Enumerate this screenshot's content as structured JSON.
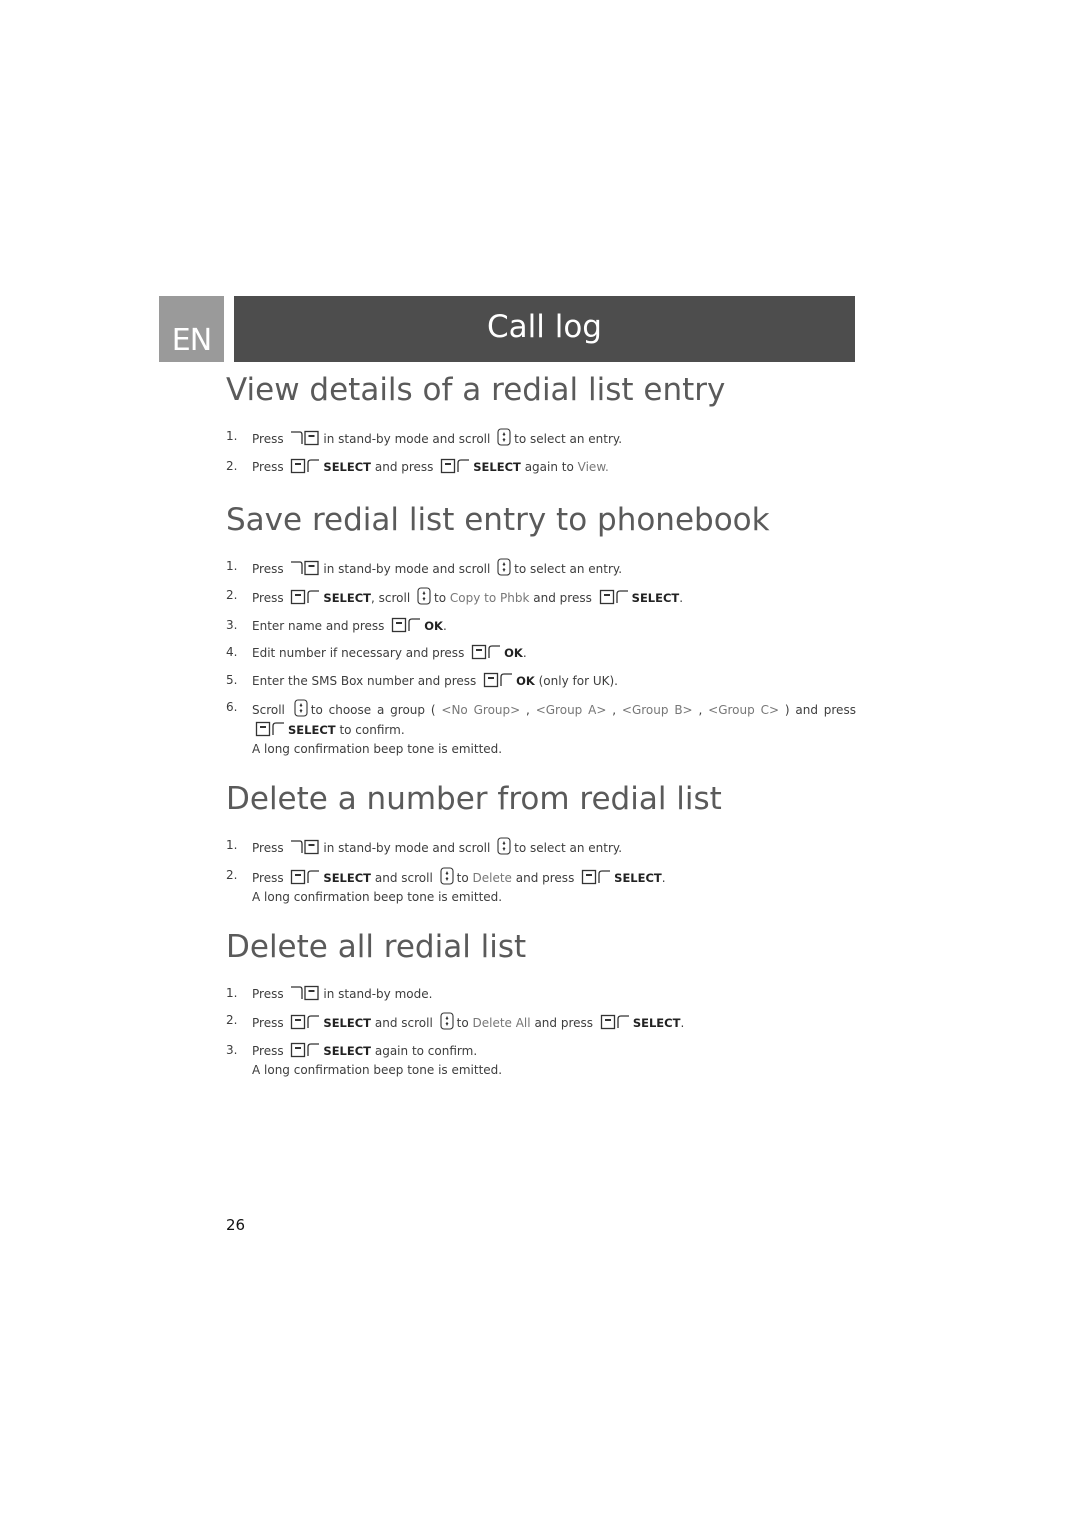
{
  "header": {
    "language": "EN",
    "title": "Call log"
  },
  "sections": [
    {
      "heading": "View details of a redial list entry",
      "steps": [
        {
          "num": "1.",
          "parts": [
            {
              "t": "text",
              "v": "Press"
            },
            {
              "t": "icon",
              "v": "call-key-icon"
            },
            {
              "t": "text",
              "v": "in stand-by mode and scroll"
            },
            {
              "t": "icon",
              "v": "nav-scroll-icon"
            },
            {
              "t": "text",
              "v": "to select an entry."
            }
          ]
        },
        {
          "num": "2.",
          "parts": [
            {
              "t": "text",
              "v": "Press"
            },
            {
              "t": "icon",
              "v": "left-softkey-icon"
            },
            {
              "t": "key",
              "v": "SELECT"
            },
            {
              "t": "text",
              "v": "and press"
            },
            {
              "t": "icon",
              "v": "left-softkey-icon"
            },
            {
              "t": "key",
              "v": "SELECT"
            },
            {
              "t": "text",
              "v": "again to"
            },
            {
              "t": "hl",
              "v": "View."
            }
          ]
        }
      ]
    },
    {
      "heading": "Save redial list entry to phonebook",
      "steps": [
        {
          "num": "1.",
          "parts": [
            {
              "t": "text",
              "v": "Press"
            },
            {
              "t": "icon",
              "v": "call-key-icon"
            },
            {
              "t": "text",
              "v": "in stand-by mode and scroll"
            },
            {
              "t": "icon",
              "v": "nav-scroll-icon"
            },
            {
              "t": "text",
              "v": "to select an entry."
            }
          ]
        },
        {
          "num": "2.",
          "parts": [
            {
              "t": "text",
              "v": "Press"
            },
            {
              "t": "icon",
              "v": "left-softkey-icon"
            },
            {
              "t": "key",
              "v": "SELECT"
            },
            {
              "t": "text",
              "v": ", scroll"
            },
            {
              "t": "icon",
              "v": "nav-scroll-icon"
            },
            {
              "t": "text",
              "v": "to"
            },
            {
              "t": "hl",
              "v": "Copy to Phbk"
            },
            {
              "t": "text",
              "v": "and press"
            },
            {
              "t": "icon",
              "v": "left-softkey-icon"
            },
            {
              "t": "key",
              "v": "SELECT"
            },
            {
              "t": "text",
              "v": "."
            }
          ]
        },
        {
          "num": "3.",
          "parts": [
            {
              "t": "text",
              "v": "Enter name and press"
            },
            {
              "t": "icon",
              "v": "left-softkey-icon"
            },
            {
              "t": "key",
              "v": "OK"
            },
            {
              "t": "text",
              "v": "."
            }
          ]
        },
        {
          "num": "4.",
          "parts": [
            {
              "t": "text",
              "v": "Edit number if necessary and press"
            },
            {
              "t": "icon",
              "v": "left-softkey-icon"
            },
            {
              "t": "key",
              "v": "OK"
            },
            {
              "t": "text",
              "v": "."
            }
          ]
        },
        {
          "num": "5.",
          "parts": [
            {
              "t": "text",
              "v": "Enter the SMS Box number and press"
            },
            {
              "t": "icon",
              "v": "left-softkey-icon"
            },
            {
              "t": "key",
              "v": "OK"
            },
            {
              "t": "text",
              "v": "(only for UK)."
            }
          ]
        },
        {
          "num": "6.",
          "justify": true,
          "parts": [
            {
              "t": "text",
              "v": "Scroll"
            },
            {
              "t": "icon",
              "v": "nav-scroll-icon"
            },
            {
              "t": "text",
              "v": "to choose a group ("
            },
            {
              "t": "hl",
              "v": "<No Group>"
            },
            {
              "t": "text",
              "v": ","
            },
            {
              "t": "hl",
              "v": "<Group A>"
            },
            {
              "t": "text",
              "v": ","
            },
            {
              "t": "hl",
              "v": "<Group B>"
            },
            {
              "t": "text",
              "v": ","
            },
            {
              "t": "hl",
              "v": "<Group C>"
            },
            {
              "t": "text",
              "v": ") and press"
            },
            {
              "t": "icon",
              "v": "left-softkey-icon"
            },
            {
              "t": "key",
              "v": "SELECT"
            },
            {
              "t": "text",
              "v": "to confirm."
            }
          ],
          "note": "A long confirmation beep tone is emitted."
        }
      ]
    },
    {
      "heading": "Delete a number from redial list",
      "steps": [
        {
          "num": "1.",
          "parts": [
            {
              "t": "text",
              "v": "Press"
            },
            {
              "t": "icon",
              "v": "call-key-icon"
            },
            {
              "t": "text",
              "v": "in stand-by mode and scroll"
            },
            {
              "t": "icon",
              "v": "nav-scroll-icon"
            },
            {
              "t": "text",
              "v": "to select an entry."
            }
          ]
        },
        {
          "num": "2.",
          "parts": [
            {
              "t": "text",
              "v": "Press"
            },
            {
              "t": "icon",
              "v": "left-softkey-icon"
            },
            {
              "t": "key",
              "v": "SELECT"
            },
            {
              "t": "text",
              "v": "and scroll"
            },
            {
              "t": "icon",
              "v": "nav-scroll-icon"
            },
            {
              "t": "text",
              "v": "to"
            },
            {
              "t": "hl",
              "v": "Delete"
            },
            {
              "t": "text",
              "v": "and press"
            },
            {
              "t": "icon",
              "v": "left-softkey-icon"
            },
            {
              "t": "key",
              "v": "SELECT"
            },
            {
              "t": "text",
              "v": "."
            }
          ],
          "note": "A long confirmation beep tone is emitted."
        }
      ]
    },
    {
      "heading": "Delete all redial list",
      "steps": [
        {
          "num": "1.",
          "parts": [
            {
              "t": "text",
              "v": "Press"
            },
            {
              "t": "icon",
              "v": "call-key-icon"
            },
            {
              "t": "text",
              "v": "in stand-by mode."
            }
          ]
        },
        {
          "num": "2.",
          "parts": [
            {
              "t": "text",
              "v": "Press"
            },
            {
              "t": "icon",
              "v": "left-softkey-icon"
            },
            {
              "t": "key",
              "v": "SELECT"
            },
            {
              "t": "text",
              "v": "and scroll"
            },
            {
              "t": "icon",
              "v": "nav-scroll-icon"
            },
            {
              "t": "text",
              "v": "to"
            },
            {
              "t": "hl",
              "v": "Delete All"
            },
            {
              "t": "text",
              "v": "and press"
            },
            {
              "t": "icon",
              "v": "left-softkey-icon"
            },
            {
              "t": "key",
              "v": "SELECT"
            },
            {
              "t": "text",
              "v": "."
            }
          ]
        },
        {
          "num": "3.",
          "parts": [
            {
              "t": "text",
              "v": "Press"
            },
            {
              "t": "icon",
              "v": "left-softkey-icon"
            },
            {
              "t": "key",
              "v": "SELECT"
            },
            {
              "t": "text",
              "v": "again to confirm."
            }
          ],
          "note": "A long confirmation beep tone is emitted."
        }
      ]
    }
  ],
  "footer": {
    "page_number": "26"
  }
}
